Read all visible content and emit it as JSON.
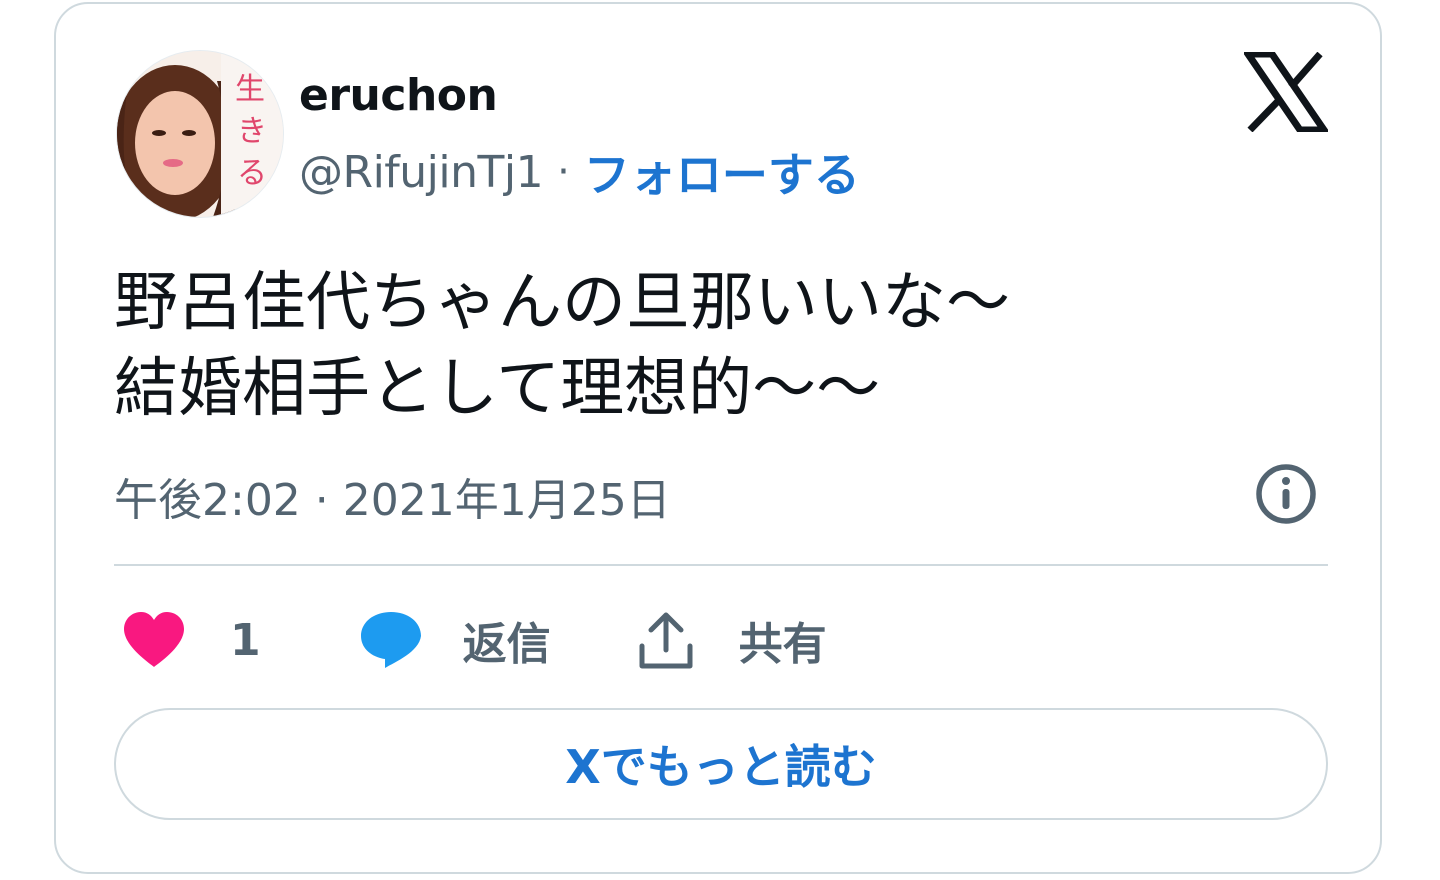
{
  "author": {
    "name": "eruchon",
    "handle": "@RifujinTj1",
    "separator": "·",
    "follow_label": "フォローする",
    "avatar_text": "生きる"
  },
  "tweet": {
    "lines": [
      "野呂佳代ちゃんの旦那いいな〜",
      "結婚相手として理想的〜〜"
    ],
    "timestamp": "午後2:02 · 2021年1月25日"
  },
  "actions": {
    "like_count": "1",
    "reply_label": "返信",
    "share_label": "共有"
  },
  "read_more_label": "Xでもっと読む",
  "icons": {
    "brand": "x-logo-icon",
    "info": "info-icon",
    "like": "heart-icon",
    "reply": "speech-bubble-icon",
    "share": "share-upload-icon"
  },
  "colors": {
    "text": "#0f1419",
    "secondary": "#536471",
    "link": "#1d74d0",
    "heart": "#f91880",
    "reply_bubble": "#1d9bf0",
    "border": "#cfd9de"
  }
}
